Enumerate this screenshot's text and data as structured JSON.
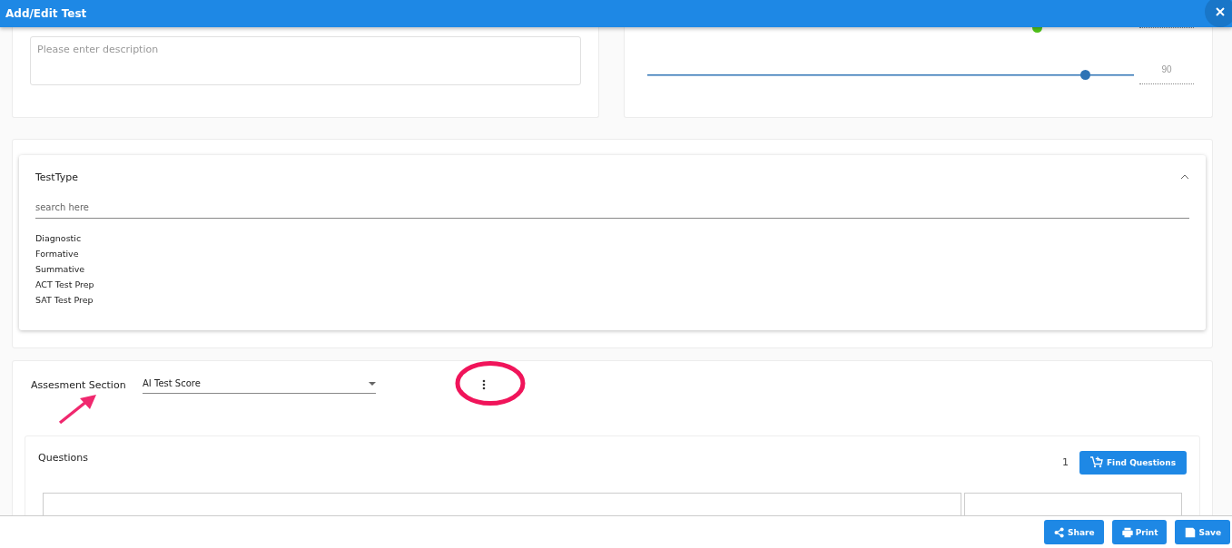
{
  "dialog": {
    "title": "Add/Edit Test"
  },
  "description": {
    "placeholder": "Please enter description"
  },
  "sliders": [
    {
      "level": 0.8,
      "color": "#52c41a"
    },
    {
      "level": 0.9,
      "color": "#2f74b5",
      "reading": "90"
    }
  ],
  "test_type": {
    "title": "TestType",
    "expanded": true,
    "search": {
      "placeholder": "search here"
    },
    "options": [
      "Diagnostic",
      "Formative",
      "Summative",
      "ACT Test Prep",
      "SAT Test Prep"
    ]
  },
  "assessment": {
    "label": "Assesment Section",
    "select": {
      "value": "AI Test Score"
    }
  },
  "questions": {
    "title": "Questions",
    "count": "1",
    "find_button": "Find Questions"
  },
  "footer_buttons": [
    {
      "label": "Share",
      "kind": "share"
    },
    {
      "label": "Print",
      "kind": "print"
    },
    {
      "label": "Save",
      "kind": "save"
    }
  ]
}
